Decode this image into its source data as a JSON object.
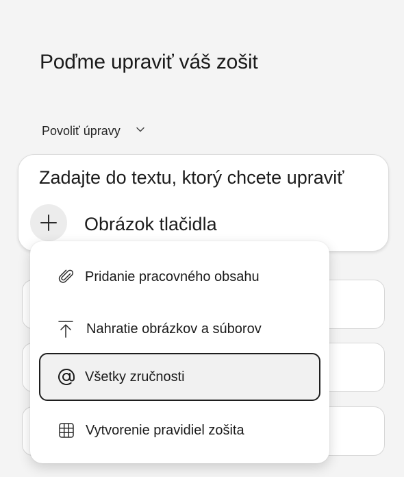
{
  "header": {
    "title": "Poďme upraviť váš zošit"
  },
  "mode_selector": {
    "label": "Povoliť úpravy",
    "icon": "chevron-down-icon"
  },
  "composer": {
    "prompt_text": "Zadajte do textu, ktorý chcete upraviť",
    "add_button_icon": "plus-icon",
    "image_button_label": "Obrázok tlačidla"
  },
  "menu": {
    "items": [
      {
        "label": "Pridanie pracovného obsahu",
        "icon": "paperclip-icon",
        "selected": false
      },
      {
        "label": "Nahratie obrázkov a súborov",
        "icon": "upload-icon",
        "selected": false
      },
      {
        "label": "Všetky zručnosti",
        "icon": "at-sign-icon",
        "selected": true
      },
      {
        "label": "Vytvorenie pravidiel zošita",
        "icon": "table-icon",
        "selected": false
      }
    ]
  }
}
